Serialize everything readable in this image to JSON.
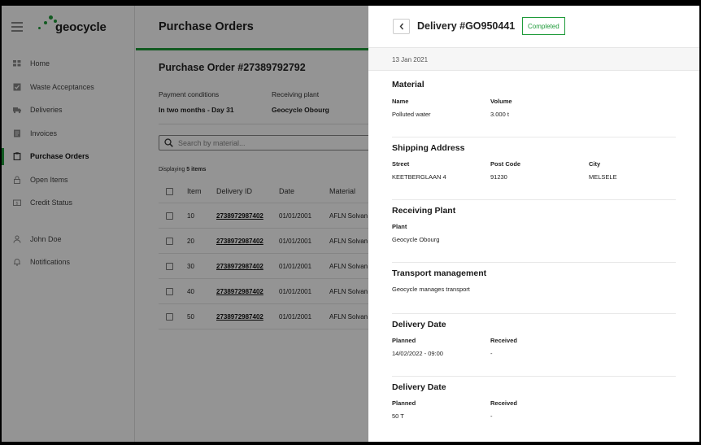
{
  "brand": {
    "name": "geocycle",
    "accent": "#1f9b3a"
  },
  "sidebar": {
    "items": [
      {
        "label": "Home",
        "icon": "home-icon"
      },
      {
        "label": "Waste Acceptances",
        "icon": "check-square-icon"
      },
      {
        "label": "Deliveries",
        "icon": "truck-icon"
      },
      {
        "label": "Invoices",
        "icon": "invoice-icon"
      },
      {
        "label": "Purchase Orders",
        "icon": "clipboard-icon",
        "active": true
      },
      {
        "label": "Open Items",
        "icon": "lock-icon"
      },
      {
        "label": "Credit Status",
        "icon": "money-icon"
      }
    ],
    "user": {
      "label": "John Doe",
      "icon": "user-icon"
    },
    "notifications": {
      "label": "Notifications",
      "icon": "bell-icon"
    }
  },
  "main": {
    "title": "Purchase Orders",
    "po_title": "Purchase Order #27389792792",
    "payment": {
      "label": "Payment conditions",
      "value": "In two months - Day 31"
    },
    "plant": {
      "label": "Receiving plant",
      "value": "Geocycle Obourg"
    },
    "search_placeholder": "Search by material...",
    "displaying_prefix": "Displaying",
    "displaying_count": "5 items",
    "table": {
      "headers": [
        "Item",
        "Delivery ID",
        "Date",
        "Material"
      ],
      "rows": [
        {
          "item": "10",
          "id": "2738972987402",
          "date": "01/01/2001",
          "material": "AFLN Solvan"
        },
        {
          "item": "20",
          "id": "2738972987402",
          "date": "01/01/2001",
          "material": "AFLN Solvan"
        },
        {
          "item": "30",
          "id": "2738972987402",
          "date": "01/01/2001",
          "material": "AFLN Solvan"
        },
        {
          "item": "40",
          "id": "2738972987402",
          "date": "01/01/2001",
          "material": "AFLN Solvan"
        },
        {
          "item": "50",
          "id": "2738972987402",
          "date": "01/01/2001",
          "material": "AFLN Solvan"
        }
      ]
    }
  },
  "drawer": {
    "title": "Delivery #GO950441",
    "status": "Completed",
    "date": "13 Jan 2021",
    "material": {
      "title": "Material",
      "name_label": "Name",
      "name": "Polluted water",
      "volume_label": "Volume",
      "volume": "3.000 t"
    },
    "shipping": {
      "title": "Shipping Address",
      "street_label": "Street",
      "street": "KEETBERGLAAN 4",
      "post_label": "Post Code",
      "post": "91230",
      "city_label": "City",
      "city": "MELSELE"
    },
    "plant": {
      "title": "Receiving Plant",
      "plant_label": "Plant",
      "plant": "Geocycle Obourg"
    },
    "transport": {
      "title": "Transport management",
      "text": "Geocycle manages transport"
    },
    "delivery1": {
      "title": "Delivery Date",
      "planned_label": "Planned",
      "planned": "14/02/2022 - 09:00",
      "received_label": "Received",
      "received": "-"
    },
    "delivery2": {
      "title": "Delivery Date",
      "planned_label": "Planned",
      "planned": "50 T",
      "received_label": "Received",
      "received": "-"
    }
  }
}
